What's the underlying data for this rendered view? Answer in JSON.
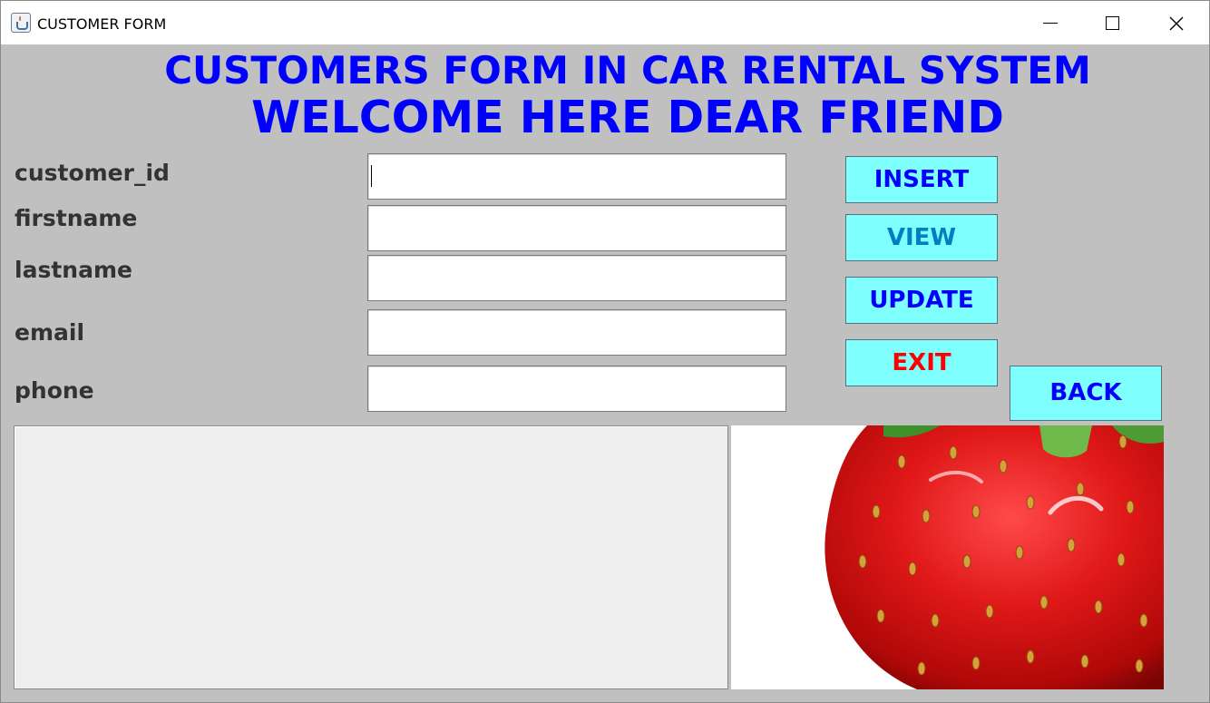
{
  "window": {
    "title": "CUSTOMER FORM"
  },
  "header": {
    "title_line1": "CUSTOMERS FORM IN CAR RENTAL SYSTEM",
    "title_line2": "WELCOME HERE DEAR FRIEND"
  },
  "form": {
    "fields": [
      {
        "label": "customer_id",
        "value": ""
      },
      {
        "label": "firstname",
        "value": ""
      },
      {
        "label": "lastname",
        "value": ""
      },
      {
        "label": "email",
        "value": ""
      },
      {
        "label": "phone",
        "value": ""
      }
    ]
  },
  "buttons": {
    "insert": "INSERT",
    "view": "VIEW",
    "update": "UPDATE",
    "exit": "EXIT",
    "back": "BACK"
  },
  "output": {
    "text": ""
  },
  "image": {
    "subject": "strawberry"
  },
  "colors": {
    "window_background": "#c0c0c0",
    "heading": "#0000ff",
    "label": "#333333",
    "button_background": "#80ffff",
    "insert_text": "#0000ff",
    "view_text": "#0080c0",
    "update_text": "#0000ff",
    "exit_text": "#ff0000",
    "back_text": "#0000ff"
  }
}
